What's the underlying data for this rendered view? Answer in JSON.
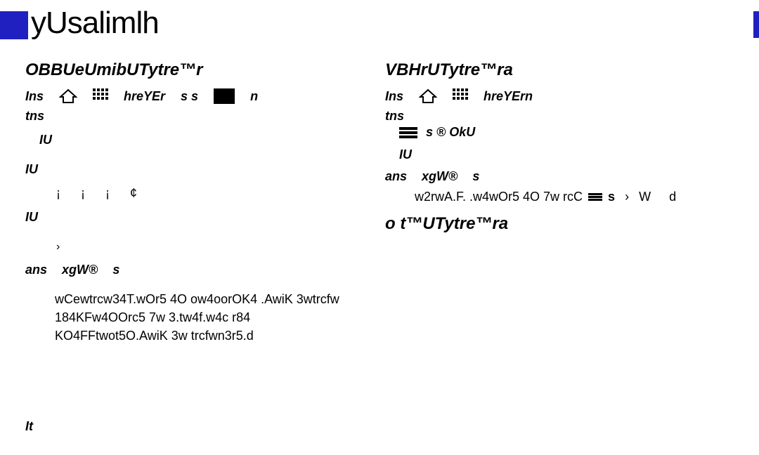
{
  "logo": "yUsalimlh",
  "left": {
    "heading": "OBBUeUmibUTytre™r",
    "row1_a": "Ins",
    "row1_b": "hreYEr",
    "row1_c": "s   s",
    "row1_d": "n",
    "tns": "tns",
    "iu1": "IU",
    "iu2": "IU",
    "codes": "¡ ¡  ¡ ¢",
    "iu3": "IU",
    "chev": "›",
    "ans": "ans",
    "ans_b": "xgW®",
    "ans_c": "s",
    "body": "wCewtrcw34T.wOr5 4O ow4oorOK4 .AwiK 3wtrcfw 184KFw4OOrc5 7w 3.tw4f.w4c r84 KO4FFtwot5O.AwiK 3w trcfwn3r5.d"
  },
  "right": {
    "heading": "VBHrUTytre™ra",
    "row1_a": "Ins",
    "row1_b": "hreYErn",
    "tns": "tns",
    "oku_a": "s ® OkU",
    "iu1": "IU",
    "ans": "ans",
    "ans_b": "xgW®",
    "ans_c": "s",
    "body": "w2rwA.F. .w4wOr5 4O 7w rcC",
    "body_b": "s",
    "body_c": "›",
    "body_d": "W",
    "body_e": "d",
    "heading2": "o t™UTytre™ra"
  },
  "footer": "It"
}
